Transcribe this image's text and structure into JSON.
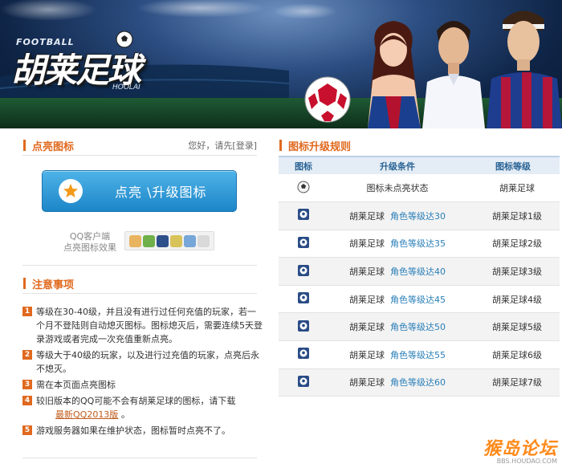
{
  "banner": {
    "logo_top": "FOOTBALL",
    "logo_main": "胡莱足球",
    "logo_tag": "HOOLAI"
  },
  "left": {
    "light_section_title": "点亮图标",
    "login_hint_prefix": "您好，请先",
    "login_link": "[登录]",
    "light_button_label": "点亮 \\升级图标",
    "qq_label_line1": "QQ客户端",
    "qq_label_line2": "点亮图标效果",
    "notes_title": "注意事项",
    "notes": [
      {
        "num": "1",
        "text": "等级在30-40级，并且没有进行过任何充值的玩家，若一个月不登陆则自动熄灭图标。图标熄灭后，需要连续5天登录游戏或者完成一次充值重新点亮。"
      },
      {
        "num": "2",
        "text": "等级大于40级的玩家，以及进行过充值的玩家，点亮后永不熄灭。"
      },
      {
        "num": "3",
        "text": "需在本页面点亮图标"
      },
      {
        "num": "4",
        "text": "较旧版本的QQ可能不会有胡莱足球的图标，请下载",
        "link": "最新QQ2013版",
        "suffix": "。"
      },
      {
        "num": "5",
        "text": "游戏服务器如果在维护状态，图标暂时点亮不了。"
      }
    ]
  },
  "right": {
    "rules_title": "图标升级规则",
    "headers": [
      "图标",
      "升级条件",
      "图标等级"
    ],
    "rows": [
      {
        "cond_prefix": "图标未点亮状态",
        "cond_level": "",
        "level": "胡莱足球"
      },
      {
        "cond_prefix": "胡莱足球",
        "cond_level": "角色等级达30",
        "level": "胡莱足球1级"
      },
      {
        "cond_prefix": "胡莱足球",
        "cond_level": "角色等级达35",
        "level": "胡莱足球2级"
      },
      {
        "cond_prefix": "胡莱足球",
        "cond_level": "角色等级达40",
        "level": "胡莱足球3级"
      },
      {
        "cond_prefix": "胡莱足球",
        "cond_level": "角色等级达45",
        "level": "胡莱足球4级"
      },
      {
        "cond_prefix": "胡莱足球",
        "cond_level": "角色等级达50",
        "level": "胡莱足球5级"
      },
      {
        "cond_prefix": "胡莱足球",
        "cond_level": "角色等级达55",
        "level": "胡莱足球6级"
      },
      {
        "cond_prefix": "胡莱足球",
        "cond_level": "角色等级达60",
        "level": "胡莱足球7级"
      }
    ]
  },
  "watermark": {
    "main": "猴岛论坛",
    "sub": "BBS.HOUDAO.COM"
  },
  "colors": {
    "accent_orange": "#e0691e",
    "button_blue": "#1c86c8",
    "level_link_blue": "#2a7fb8"
  },
  "icons": [
    "soccer-ball-icon",
    "star-icon",
    "qq-status-icons",
    "level-badge-icon"
  ]
}
